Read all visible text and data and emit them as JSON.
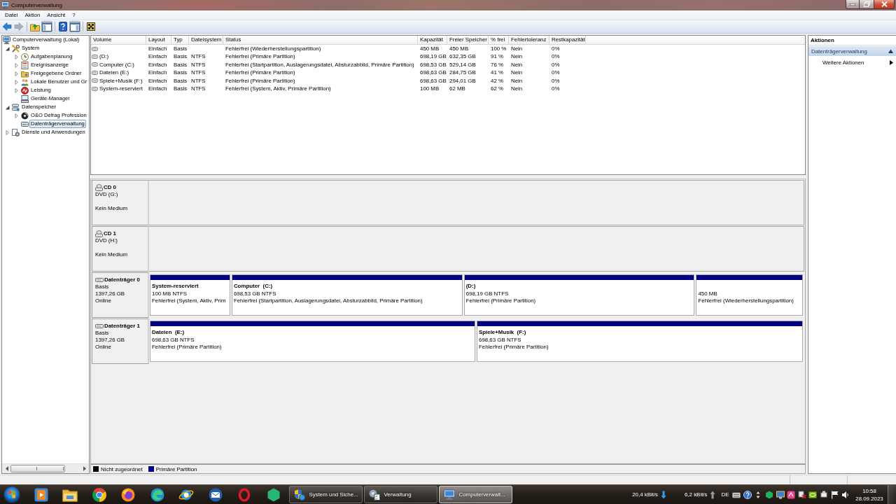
{
  "window": {
    "title": "Computerverwaltung"
  },
  "menu": [
    "Datei",
    "Aktion",
    "Ansicht",
    "?"
  ],
  "toolbar": [
    [
      {
        "pressed": false,
        "disabled": false
      },
      {
        "pressed": false,
        "disabled": true
      }
    ],
    [
      {
        "pressed": false,
        "disabled": false
      },
      {
        "pressed": true,
        "disabled": false
      }
    ],
    [
      {
        "pressed": false,
        "disabled": false
      },
      {
        "pressed": true,
        "disabled": false
      }
    ],
    [
      {
        "pressed": false,
        "disabled": false
      }
    ]
  ],
  "tree": {
    "items": [
      {
        "label": "Computerverwaltung (Lokal)",
        "selected": false,
        "children": [
          {
            "label": "System",
            "expanded": true,
            "selected": false,
            "children": [
              {
                "label": "Aufgabenplanung",
                "expanded": false,
                "selected": false
              },
              {
                "label": "Ereignisanzeige",
                "expanded": false,
                "selected": false
              },
              {
                "label": "Freigegebene Ordner",
                "expanded": false,
                "selected": false
              },
              {
                "label": "Lokale Benutzer und Gr",
                "expanded": false,
                "selected": false
              },
              {
                "label": "Leistung",
                "expanded": false,
                "selected": false
              },
              {
                "label": "Geräte-Manager",
                "selected": false
              }
            ]
          },
          {
            "label": "Datenspeicher",
            "expanded": true,
            "selected": false,
            "children": [
              {
                "label": "O&O Defrag Profession",
                "expanded": false,
                "selected": false
              },
              {
                "label": "Datenträgerverwaltung",
                "selected": true
              }
            ]
          },
          {
            "label": "Dienste und Anwendungen",
            "expanded": false,
            "selected": false
          }
        ]
      }
    ]
  },
  "volume_list": {
    "columns": [
      "Volume",
      "Layout",
      "Typ",
      "Dateisystem",
      "Status",
      "Kapazität",
      "Freier Speicher",
      "% frei",
      "Fehlertoleranz",
      "Restkapazität"
    ],
    "rows": [
      {
        "layout": "Einfach",
        "type": "Basis",
        "status": "Fehlerfrei (Wiederherstellungspartition)",
        "capacity": "450 MB",
        "free": "450 MB",
        "percent_free": "100 %",
        "fault_tolerance": "Nein",
        "overhead": "0%"
      },
      {
        "volume": "(D:)",
        "layout": "Einfach",
        "type": "Basis",
        "filesystem": "NTFS",
        "status": "Fehlerfrei (Primäre Partition)",
        "capacity": "698,19 GB",
        "free": "632,35 GB",
        "percent_free": "91 %",
        "fault_tolerance": "Nein",
        "overhead": "0%"
      },
      {
        "volume": "Computer (C:)",
        "layout": "Einfach",
        "type": "Basis",
        "filesystem": "NTFS",
        "status": "Fehlerfrei (Startpartition, Auslagerungsdatei, Absturzabbild, Primäre Partition)",
        "capacity": "698,53 GB",
        "free": "529,14 GB",
        "percent_free": "76 %",
        "fault_tolerance": "Nein",
        "overhead": "0%"
      },
      {
        "volume": "Dateien (E:)",
        "layout": "Einfach",
        "type": "Basis",
        "filesystem": "NTFS",
        "status": "Fehlerfrei (Primäre Partition)",
        "capacity": "698,63 GB",
        "free": "284,75 GB",
        "percent_free": "41 %",
        "fault_tolerance": "Nein",
        "overhead": "0%"
      },
      {
        "volume": "Spiele+Musik (F:)",
        "layout": "Einfach",
        "type": "Basis",
        "filesystem": "NTFS",
        "status": "Fehlerfrei (Primäre Partition)",
        "capacity": "698,63 GB",
        "free": "294,01 GB",
        "percent_free": "42 %",
        "fault_tolerance": "Nein",
        "overhead": "0%"
      },
      {
        "volume": "System-reserviert",
        "layout": "Einfach",
        "type": "Basis",
        "filesystem": "NTFS",
        "status": "Fehlerfrei (System, Aktiv, Primäre Partition)",
        "capacity": "100 MB",
        "free": "62 MB",
        "percent_free": "62 %",
        "fault_tolerance": "Nein",
        "overhead": "0%"
      }
    ]
  },
  "disks": [
    {
      "kind": "cd",
      "name": "CD 0",
      "type": "DVD (G:)",
      "state": "Kein Medium"
    },
    {
      "kind": "cd",
      "name": "CD 1",
      "type": "DVD (H:)",
      "state": "Kein Medium"
    },
    {
      "kind": "disk",
      "name": "Datenträger 0",
      "type": "Basis",
      "size": "1397,26 GB",
      "state": "Online",
      "partitions": [
        {
          "name": "System-reserviert",
          "size": "100 MB NTFS",
          "status": "Fehlerfrei (System, Aktiv, Prim"
        },
        {
          "name": "Computer  (C:)",
          "size": "698,53 GB NTFS",
          "status": "Fehlerfrei (Startpartition, Auslagerungsdatei, Absturzabbild, Primäre Partition)"
        },
        {
          "name": "(D:)",
          "size": "698,19 GB NTFS",
          "status": "Fehlerfrei (Primäre Partition)"
        },
        {
          "size": "450 MB",
          "status": "Fehlerfrei (Wiederherstellungspartition)"
        }
      ]
    },
    {
      "kind": "disk",
      "name": "Datenträger 1",
      "type": "Basis",
      "size": "1397,26 GB",
      "state": "Online",
      "partitions": [
        {
          "name": "Dateien  (E:)",
          "size": "698,63 GB NTFS",
          "status": "Fehlerfrei (Primäre Partition)"
        },
        {
          "name": "Spiele+Musik  (F:)",
          "size": "698,63 GB NTFS",
          "status": "Fehlerfrei (Primäre Partition)"
        }
      ]
    }
  ],
  "legend": [
    {
      "label": "Nicht zugeordnet",
      "color": "#000000"
    },
    {
      "label": "Primäre Partition",
      "color": "#000080"
    }
  ],
  "actions": {
    "title": "Aktionen",
    "sections": [
      {
        "title": "Datenträgerverwaltung",
        "expanded": true,
        "items": [
          {
            "label": "Weitere Aktionen"
          }
        ]
      }
    ]
  },
  "taskbar": {
    "tasks": [
      {
        "label": "System und Siche...",
        "selected": false
      },
      {
        "label": "Verwaltung",
        "selected": false
      },
      {
        "label": "Computerverwalt...",
        "selected": true
      }
    ],
    "download_rate": "20,4 kBit/s",
    "upload_rate": "6,2 kBit/s",
    "language": "DE",
    "time": "10:58",
    "date": "28.09.2023"
  }
}
